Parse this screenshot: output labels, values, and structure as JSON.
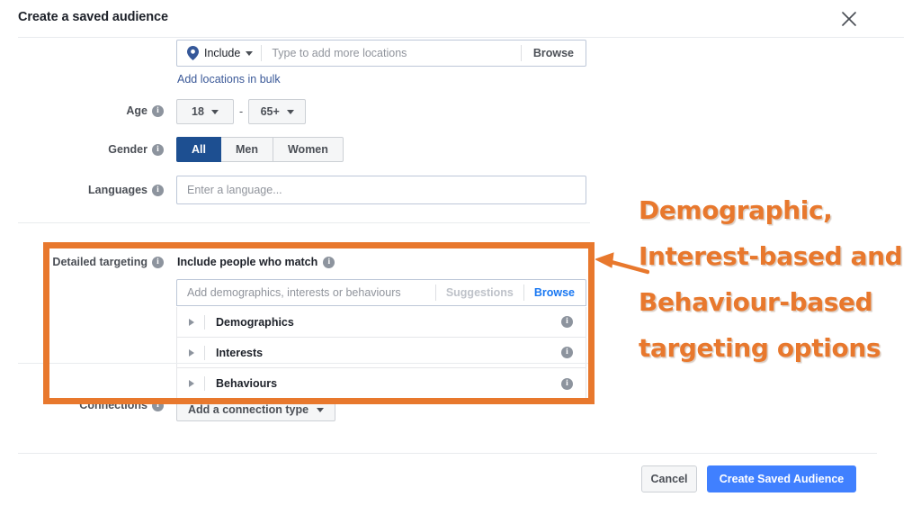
{
  "dialog": {
    "title": "Create a saved audience",
    "close_icon": "close-icon"
  },
  "location": {
    "include_label": "Include",
    "pin_icon": "location-pin-icon",
    "caret_icon": "chevron-down-icon",
    "placeholder": "Type to add more locations",
    "browse_label": "Browse",
    "bulk_link": "Add locations in bulk"
  },
  "age": {
    "label": "Age",
    "min": "18",
    "max": "65+",
    "separator": "-"
  },
  "gender": {
    "label": "Gender",
    "options": [
      {
        "label": "All",
        "selected": true
      },
      {
        "label": "Men",
        "selected": false
      },
      {
        "label": "Women",
        "selected": false
      }
    ]
  },
  "languages": {
    "label": "Languages",
    "placeholder": "Enter a language..."
  },
  "detailed_targeting": {
    "label": "Detailed targeting",
    "subtitle": "Include people who match",
    "placeholder": "Add demographics, interests or behaviours",
    "suggestions_label": "Suggestions",
    "browse_label": "Browse",
    "items": [
      {
        "label": "Demographics"
      },
      {
        "label": "Interests"
      },
      {
        "label": "Behaviours"
      }
    ]
  },
  "connections": {
    "label": "Connections",
    "button_label": "Add a connection type"
  },
  "footer": {
    "cancel_label": "Cancel",
    "primary_label": "Create Saved Audience"
  },
  "annotation": {
    "line1": "Demographic,",
    "line2": "Interest-based and",
    "line3": "Behaviour-based",
    "line4": "targeting options",
    "color": "#e8782d"
  },
  "colors": {
    "accent_blue": "#4080ff",
    "segment_active": "#1d4f91",
    "link_blue": "#3b5998",
    "browse_blue": "#1877f2",
    "annotation_orange": "#e8782d"
  }
}
